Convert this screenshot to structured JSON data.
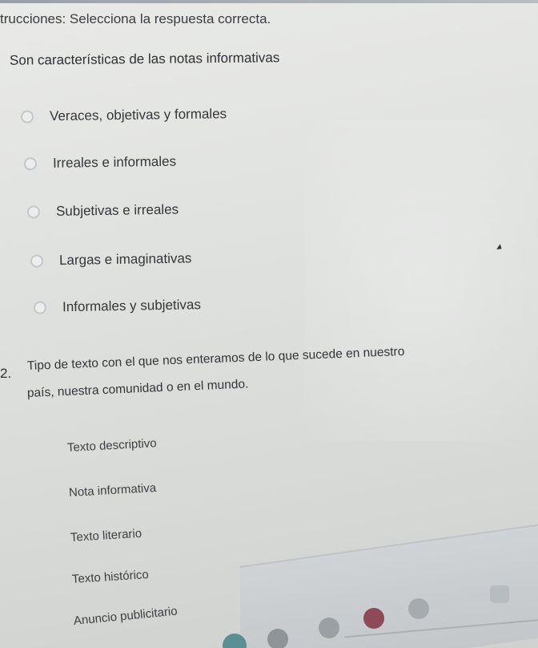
{
  "instructions": "trucciones: Selecciona la respuesta correcta.",
  "question1": {
    "title": "Son características de las notas informativas",
    "options": [
      "Veraces, objetivas y formales",
      "Irreales e informales",
      "Subjetivas e irreales",
      "Largas e imaginativas",
      "Informales y subjetivas"
    ]
  },
  "question2": {
    "number": "2.",
    "line1": "Tipo de texto con el que nos enteramos de lo que sucede en nuestro",
    "line2": "país, nuestra comunidad o en el mundo.",
    "options": [
      "Texto descriptivo",
      "Nota informativa",
      "Texto literario",
      "Texto histórico",
      "Anuncio publicitario"
    ]
  },
  "taskbar": {
    "icons": [
      "app-icon-teal",
      "app-icon-gray",
      "app-icon-gray-2",
      "app-icon-red",
      "app-icon-gray-3",
      "app-icon-square"
    ]
  },
  "colors": {
    "text": "#2f3136",
    "background": "#e2e4e2",
    "radio_border": "#c3c7cc"
  }
}
